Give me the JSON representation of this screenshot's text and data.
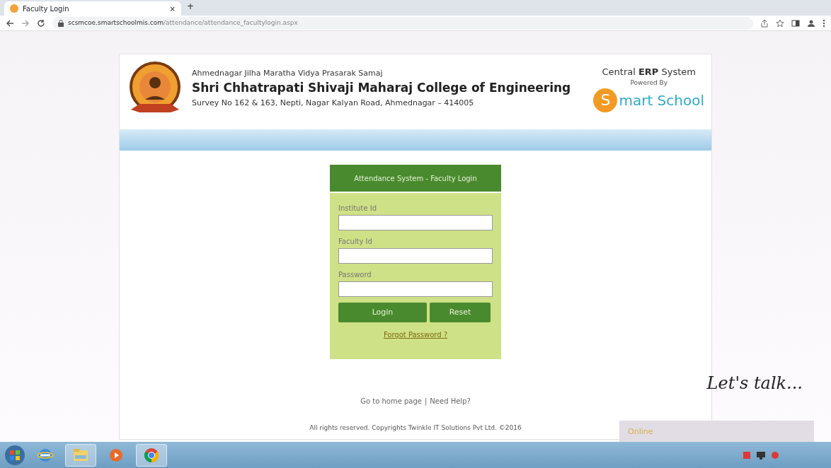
{
  "browser": {
    "tab_title": "Faculty Login",
    "tab_close": "×",
    "new_tab": "+",
    "url_host": "scsmcoe.smartschoolmis.com",
    "url_path": "/attendance/attendance_facultylogin.aspx"
  },
  "header": {
    "society": "Ahmednagar Jilha Maratha Vidya Prasarak Samaj",
    "college": "Shri Chhatrapati Shivaji Maharaj College of Engineering",
    "address": "Survey No 162 & 163, Nepti, Nagar Kalyan Road, Ahmednagar – 414005",
    "system": "Central **ERP** System",
    "powered_by": "Powered By",
    "brand_initial": "S",
    "brand_rest": "mart School"
  },
  "login": {
    "title": "Attendance System - Faculty Login",
    "fields": [
      {
        "label": "Institute Id"
      },
      {
        "label": "Faculty Id"
      },
      {
        "label": "Password"
      }
    ],
    "buttons": [
      "Login",
      "Reset"
    ],
    "forgot": "Forgot Password ?"
  },
  "footer_links": [
    "Go to home page",
    "Need Help?"
  ],
  "link_separator": "|",
  "copyright": "All rights reserved. Copyrights Twinkle IT Solutions Pvt Ltd. ©2016",
  "chat": {
    "heading": "Let's talk...",
    "status": "Online"
  },
  "taskbar": {
    "apps": [
      {
        "kind": "ie",
        "selected": false
      },
      {
        "kind": "folder",
        "selected": true
      },
      {
        "kind": "media",
        "selected": false
      },
      {
        "kind": "chrome",
        "selected": true
      }
    ]
  }
}
